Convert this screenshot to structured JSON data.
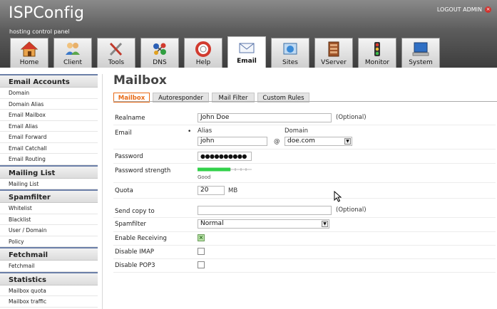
{
  "header": {
    "logo": "ISPConfig",
    "tagline": "hosting control panel",
    "logout": "LOGOUT ADMIN"
  },
  "tabs": [
    {
      "label": "Home",
      "icon": "home-icon"
    },
    {
      "label": "Client",
      "icon": "client-icon"
    },
    {
      "label": "Tools",
      "icon": "tools-icon"
    },
    {
      "label": "DNS",
      "icon": "dns-icon"
    },
    {
      "label": "Help",
      "icon": "help-icon"
    },
    {
      "label": "Email",
      "icon": "email-icon",
      "active": true
    },
    {
      "label": "Sites",
      "icon": "sites-icon"
    },
    {
      "label": "VServer",
      "icon": "vserver-icon"
    },
    {
      "label": "Monitor",
      "icon": "monitor-icon"
    },
    {
      "label": "System",
      "icon": "system-icon"
    }
  ],
  "sidebar": {
    "groups": [
      {
        "title": "Email Accounts",
        "items": [
          "Domain",
          "Domain Alias",
          "Email Mailbox",
          "Email Alias",
          "Email Forward",
          "Email Catchall",
          "Email Routing"
        ]
      },
      {
        "title": "Mailing List",
        "items": [
          "Mailing List"
        ]
      },
      {
        "title": "Spamfilter",
        "items": [
          "Whitelist",
          "Blacklist",
          "User / Domain",
          "Policy"
        ]
      },
      {
        "title": "Fetchmail",
        "items": [
          "Fetchmail"
        ]
      },
      {
        "title": "Statistics",
        "items": [
          "Mailbox quota",
          "Mailbox traffic"
        ]
      }
    ]
  },
  "main": {
    "title": "Mailbox",
    "subtabs": [
      "Mailbox",
      "Autoresponder",
      "Mail Filter",
      "Custom Rules"
    ],
    "form": {
      "realname_label": "Realname",
      "realname_value": "John Doe",
      "optional": "(Optional)",
      "email_label": "Email",
      "alias_label": "Alias",
      "alias_value": "john",
      "at": "@",
      "domain_label": "Domain",
      "domain_value": "doe.com",
      "password_label": "Password",
      "password_value": "●●●●●●●●●●",
      "strength_label": "Password strength",
      "strength_text": "Good",
      "strength_fraction": 0.6,
      "quota_label": "Quota",
      "quota_value": "20",
      "quota_unit": "MB",
      "sendcopy_label": "Send copy to",
      "sendcopy_value": "",
      "sendcopy_optional": "(Optional)",
      "spamfilter_label": "Spamfilter",
      "spamfilter_value": "Normal",
      "receiving_label": "Enable Receiving",
      "receiving_checked": true,
      "imap_label": "Disable IMAP",
      "pop3_label": "Disable POP3"
    }
  },
  "colors": {
    "accent": "#e86a16",
    "strength_bar": "#32d14a",
    "sidebar_border": "#6b7fa8"
  }
}
